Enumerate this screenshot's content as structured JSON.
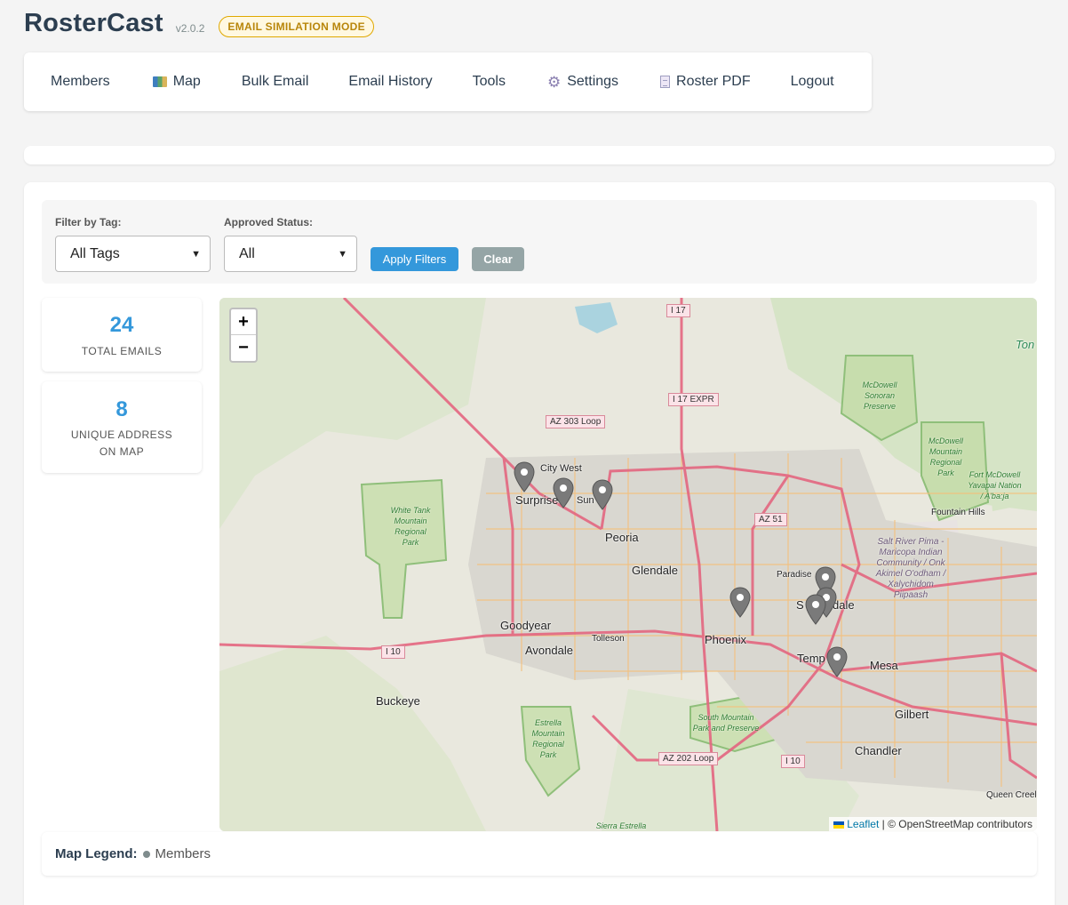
{
  "app": {
    "title": "RosterCast",
    "version": "v2.0.2",
    "mode_badge": "EMAIL SIMILATION MODE"
  },
  "nav": {
    "members": "Members",
    "map": "Map",
    "bulk_email": "Bulk Email",
    "email_history": "Email History",
    "tools": "Tools",
    "settings": "Settings",
    "roster_pdf": "Roster PDF",
    "logout": "Logout"
  },
  "filters": {
    "tag_label": "Filter by Tag:",
    "tag_value": "All Tags",
    "status_label": "Approved Status:",
    "status_value": "All",
    "apply_label": "Apply Filters",
    "clear_label": "Clear"
  },
  "stats": {
    "total_emails_value": "24",
    "total_emails_label": "TOTAL EMAILS",
    "unique_address_value": "8",
    "unique_address_label_1": "UNIQUE ADDRESS",
    "unique_address_label_2": "ON MAP"
  },
  "map": {
    "zoom_in": "+",
    "zoom_out": "−",
    "attribution_leaflet": "Leaflet",
    "attribution_rest": "| © OpenStreetMap contributors",
    "cities": {
      "surprise": "Surprise",
      "sun_city_west": "City West",
      "sun": "Sun",
      "peoria": "Peoria",
      "glendale": "Glendale",
      "goodyear": "Goodyear",
      "avondale": "Avondale",
      "tolleson": "Tolleson",
      "phoenix": "Phoenix",
      "buckeye": "Buckeye",
      "paradise": "Paradise",
      "scottsdale_a": "S",
      "scottsdale_b": "dale",
      "tempe": "Temp",
      "mesa": "Mesa",
      "gilbert": "Gilbert",
      "chandler": "Chandler",
      "queen_creek": "Queen Creel",
      "fountain_hills": "Fountain Hills",
      "tonto": "Ton"
    },
    "parks": {
      "white_tank": "White Tank Mountain Regional Park",
      "estrella": "Estrella Mountain Regional Park",
      "south_mountain": "South Mountain Park and Preserve",
      "mcdowell_sonoran": "McDowell Sonoran Preserve",
      "mcdowell_regional": "McDowell Mountain Regional Park",
      "fort_mcdowell": "Fort McDowell Yavapai Nation / A'ba:ja",
      "salt_river": "Salt River Pima - Maricopa Indian Community / Onk Akimel O'odham / Xalychidom Piipaash",
      "sierra_estrella": "Sierra Estrella"
    },
    "shields": {
      "i17": "I 17",
      "i17_expr": "I 17 EXPR",
      "az303": "AZ 303 Loop",
      "az51": "AZ 51",
      "i10_west": "I 10",
      "i10_east": "I 10",
      "az202": "AZ 202 Loop"
    },
    "marker_color": "#7a7a7a"
  },
  "legend": {
    "title": "Map Legend:",
    "members": "Members"
  }
}
